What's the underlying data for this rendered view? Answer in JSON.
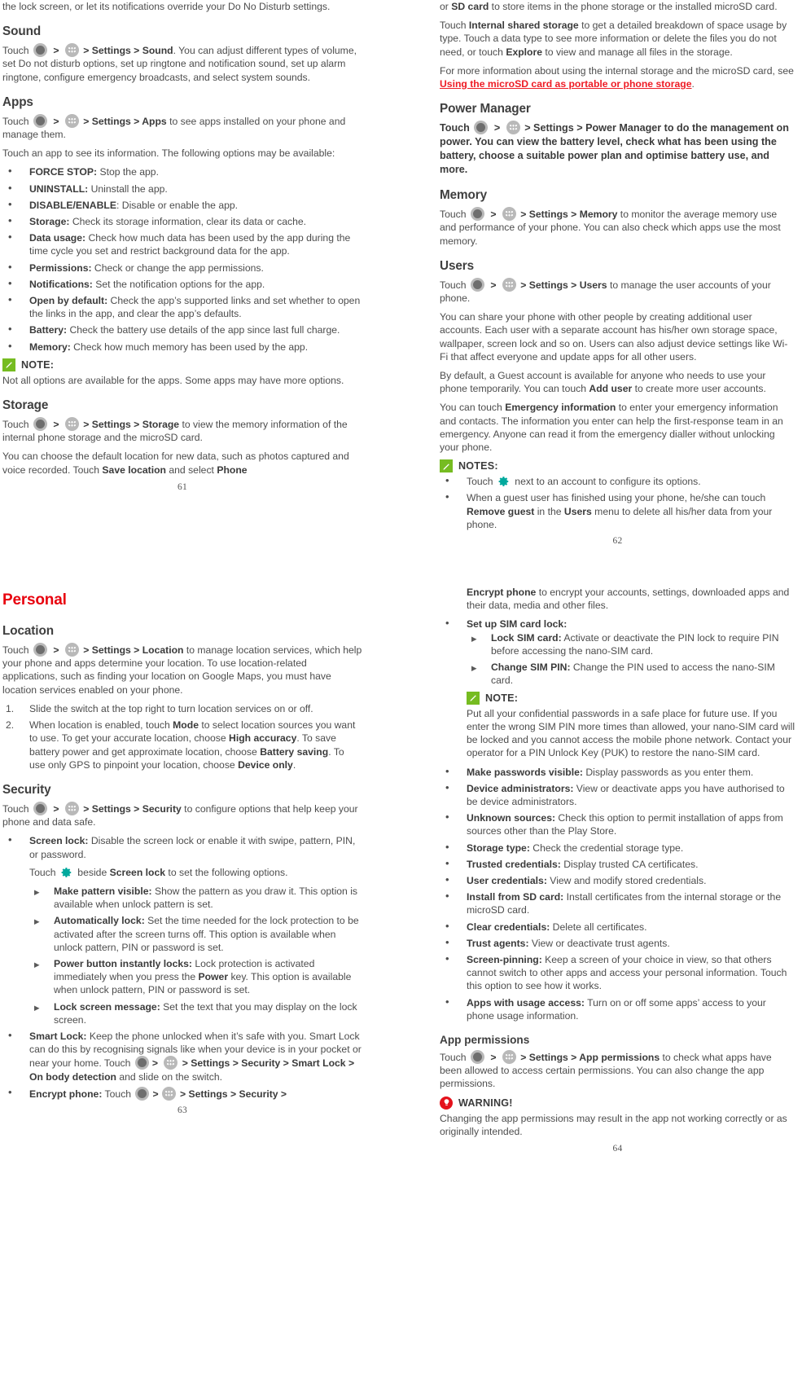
{
  "colors": {
    "accent_red": "#ee1c25",
    "note_green": "#76bc21",
    "warning_red": "#e4121c",
    "body_text": "#4d4d4d"
  },
  "icons": {
    "home": "home-circle-icon",
    "apps": "app-drawer-icon",
    "gear": "gear-icon",
    "note": "pencil-note-icon",
    "warning": "lightbulb-warning-icon"
  },
  "pages": {
    "p61": {
      "folio": "61",
      "cont_text": "the lock screen, or let its notifications override your Do No Disturb settings.",
      "sound": {
        "heading": "Sound",
        "touch": "Touch",
        "gt": ">",
        "path": "> Settings > Sound",
        "body": ". You can adjust different types of volume, set Do not disturb options, set up ringtone and notification sound, set up alarm ringtone, configure emergency broadcasts, and select system sounds."
      },
      "apps": {
        "heading": "Apps",
        "touch": "Touch",
        "path": "> Settings > Apps",
        "body": " to see apps installed on your phone and manage them.",
        "intro": "Touch an app to see its information. The following options may be available:",
        "items": [
          {
            "term": "FORCE STOP:",
            "desc": " Stop the app."
          },
          {
            "term": "UNINSTALL:",
            "desc": " Uninstall the app."
          },
          {
            "term": "DISABLE/ENABLE",
            "desc": ": Disable or enable the app."
          },
          {
            "term": "Storage:",
            "desc": " Check its storage information, clear its data or cache."
          },
          {
            "term": "Data usage:",
            "desc": " Check how much data has been used by the app during the time cycle you set and restrict background data for the app."
          },
          {
            "term": "Permissions:",
            "desc": " Check or change the app permissions."
          },
          {
            "term": "Notifications:",
            "desc": " Set the notification options for the app."
          },
          {
            "term": "Open by default:",
            "desc": " Check the app’s supported links and set whether to open the links in the app, and clear the app’s defaults."
          },
          {
            "term": "Battery:",
            "desc": " Check the battery use details of the app since last full charge."
          },
          {
            "term": "Memory:",
            "desc": " Check how much memory has been used by the app."
          }
        ],
        "note_label": "NOTE:",
        "note_text": "Not all options are available for the apps. Some apps may have more options."
      },
      "storage": {
        "heading": "Storage",
        "touch": "Touch",
        "path": "> Settings > Storage",
        "body": " to view the memory information of the internal phone storage and the microSD card.",
        "para2_a": "You can choose the default location for new data, such as photos captured and voice recorded. Touch ",
        "para2_b": "Save location",
        "para2_c": " and select ",
        "para2_d": "Phone"
      }
    },
    "p62": {
      "folio": "62",
      "cont_a": "or ",
      "cont_b": "SD card",
      "cont_c": " to store items in the phone storage or the installed microSD card.",
      "internal_a": "Touch ",
      "internal_b": "Internal shared storage",
      "internal_c": " to get a detailed breakdown of space usage by type. Touch a data type to see more information or delete the files you do not need, or touch ",
      "internal_d": "Explore",
      "internal_e": " to view and manage all files in the storage.",
      "moreinfo_a": "For more information about using the internal storage and the microSD card, see ",
      "moreinfo_link": "Using the microSD card as portable or phone storage",
      "moreinfo_b": ".",
      "power": {
        "heading": "Power Manager",
        "touch": "Touch",
        "path": "> Settings > Power Manager",
        "body": " to do the management on power. You can view the battery level, check what has been using the battery, choose a suitable power plan and optimise battery use, and more."
      },
      "memory": {
        "heading": "Memory",
        "touch": "Touch",
        "path": "> Settings > Memory",
        "body": " to monitor the average memory use and performance of your phone. You can also check which apps use the most memory."
      },
      "users": {
        "heading": "Users",
        "touch": "Touch",
        "path": "> Settings > Users",
        "body": " to manage the user accounts of your phone.",
        "para2": "You can share your phone with other people by creating additional user accounts. Each user with a separate account has his/her own storage space, wallpaper, screen lock and so on. Users can also adjust device settings like Wi-Fi that affect everyone and update apps for all other users.",
        "para3_a": "By default, a Guest account is available for anyone who needs to use your phone temporarily. You can touch ",
        "para3_b": "Add user",
        "para3_c": " to create more user accounts.",
        "para4_a": "You can touch ",
        "para4_b": "Emergency information",
        "para4_c": " to enter your emergency information and contacts. The information you enter can help the first-response team in an emergency. Anyone can read it from the emergency dialler without unlocking your phone.",
        "notes_label": "NOTES:",
        "note1_a": "Touch ",
        "note1_b": " next to an account to configure its options.",
        "note2_a": "When a guest user has finished using your phone, he/she can touch ",
        "note2_b": "Remove guest",
        "note2_c": " in the ",
        "note2_d": "Users",
        "note2_e": " menu to delete all his/her data from your phone."
      }
    },
    "p63": {
      "folio": "63",
      "chapter": "Personal",
      "location": {
        "heading": "Location",
        "touch": "Touch",
        "path": "> Settings > Location",
        "body": " to manage location services, which help your phone and apps determine your location. To use location-related applications, such as finding your location on Google Maps, you must have location services enabled on your phone.",
        "step1": "Slide the switch at the top right to turn location services on or off.",
        "step2_a": "When location is enabled, touch ",
        "step2_b": "Mode",
        "step2_c": " to select location sources you want to use. To get your accurate location, choose ",
        "step2_d": "High accuracy",
        "step2_e": ". To save battery power and get approximate location, choose ",
        "step2_f": "Battery saving",
        "step2_g": ". To use only GPS to pinpoint your location, choose ",
        "step2_h": "Device only",
        "step2_i": "."
      },
      "security": {
        "heading": "Security",
        "touch": "Touch",
        "path": "> Settings > Security",
        "body": " to configure options that help keep your phone and data safe.",
        "screenlock_term": "Screen lock:",
        "screenlock_desc": " Disable the screen lock or enable it with swipe, pattern, PIN, or password.",
        "gear_line_a": "Touch ",
        "gear_line_b": " beside ",
        "gear_line_c": "Screen lock",
        "gear_line_d": " to set the following options.",
        "sub_items": [
          {
            "term": "Make pattern visible:",
            "desc": " Show the pattern as you draw it. This option is available when unlock pattern is set."
          },
          {
            "term": "Automatically lock:",
            "desc": " Set the time needed for the lock protection to be activated after the screen turns off. This option is available when unlock pattern, PIN or password is set."
          },
          {
            "term": "Power button instantly locks:",
            "desc_pre": " Lock protection is activated immediately when you press the ",
            "desc_bold": "Power",
            "desc_post": " key. This option is available when unlock pattern, PIN or password is set."
          },
          {
            "term": "Lock screen message:",
            "desc": " Set the text that you may display on the lock screen."
          }
        ],
        "smartlock_term": "Smart Lock:",
        "smartlock_a": " Keep the phone unlocked when it’s safe with you. Smart Lock can do this by recognising signals like when your device is in your pocket or near your home. Touch ",
        "smartlock_path": "> Settings > Security > Smart Lock > On body detection",
        "smartlock_b": " and slide on the switch.",
        "encrypt_term": "Encrypt phone:",
        "encrypt_touch": " Touch ",
        "encrypt_path": "> Settings > Security >"
      }
    },
    "p64": {
      "folio": "64",
      "encrypt_cont_b": "Encrypt phone",
      "encrypt_cont_c": " to encrypt your accounts, settings, downloaded apps and their data, media and other files.",
      "sim": {
        "term": "Set up SIM card lock:",
        "items": [
          {
            "term": "Lock SIM card:",
            "desc": " Activate or deactivate the PIN lock to require PIN before accessing the nano-SIM card."
          },
          {
            "term": "Change SIM PIN:",
            "desc": " Change the PIN used to access the nano-SIM card."
          }
        ],
        "note_label": "NOTE:",
        "note_text": "Put all your confidential passwords in a safe place for future use. If you enter the wrong SIM PIN more times than allowed, your nano-SIM card will be locked and you cannot access the mobile phone network. Contact your operator for a PIN Unlock Key (PUK) to restore the nano-SIM card."
      },
      "sec_items": [
        {
          "term": "Make passwords visible:",
          "desc": " Display passwords as you enter them."
        },
        {
          "term": "Device administrators:",
          "desc": " View or deactivate apps you have authorised to be device administrators."
        },
        {
          "term": "Unknown sources:",
          "desc": " Check this option to permit installation of apps from sources other than the Play Store."
        },
        {
          "term": "Storage type:",
          "desc": " Check the credential storage type."
        },
        {
          "term": "Trusted credentials:",
          "desc": " Display trusted CA certificates."
        },
        {
          "term": "User credentials:",
          "desc": " View and modify stored credentials."
        },
        {
          "term": "Install from SD card:",
          "desc": " Install certificates from the internal storage or the microSD card."
        },
        {
          "term": "Clear credentials:",
          "desc": " Delete all certificates."
        },
        {
          "term": "Trust agents:",
          "desc": " View or deactivate trust agents."
        },
        {
          "term": "Screen-pinning:",
          "desc": " Keep a screen of your choice in view, so that others cannot switch to other apps and access your personal information. Touch this option to see how it works."
        },
        {
          "term": "Apps with usage access:",
          "desc": " Turn on or off some apps’ access to your phone usage information."
        }
      ],
      "appperm": {
        "heading": "App permissions",
        "touch": "Touch",
        "path": "> Settings > App permissions",
        "body": " to check what apps have been allowed to access certain permissions. You can also change the app permissions.",
        "warn_label": "WARNING!",
        "warn_text": "Changing the app permissions may result in the app not working correctly or as originally intended."
      }
    }
  }
}
